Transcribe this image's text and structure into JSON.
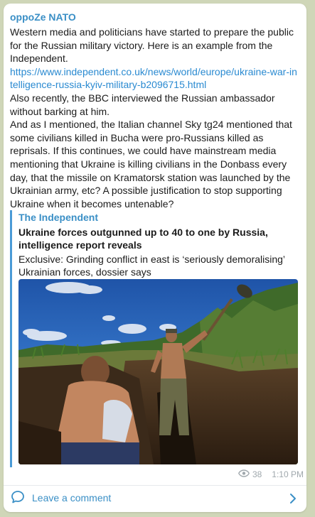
{
  "channel": {
    "name": "oppoZe NATO"
  },
  "message": {
    "p1": "Western media and politicians have started to prepare the public for the Russian military victory. Here is an example from the Independent.",
    "link": "https://www.independent.co.uk/news/world/europe/ukraine-war-intelligence-russia-kyiv-military-b2096715.html",
    "p2": "Also recently, the BBC interviewed the Russian ambassador without barking at him.",
    "p3": "And as I mentioned, the Italian channel Sky tg24 mentioned that some civilians killed in Bucha were pro-Russians killed as reprisals. If this continues, we could have mainstream media mentioning that Ukraine is killing civilians in the Donbass every day, that the missile on Kramatorsk station was launched by the Ukrainian army, etc? A possible justification to stop supporting Ukraine when it becomes untenable?"
  },
  "preview": {
    "site": "The Independent",
    "title": "Ukraine forces outgunned up to 40 to one by Russia, intelligence report reveals",
    "description": "Exclusive: Grinding conflict in east is ‘seriously demoralising’ Ukrainian forces, dossier says"
  },
  "meta": {
    "views": "38",
    "time": "1:10 PM",
    "view_icon": "eye-icon"
  },
  "footer": {
    "comment_label": "Leave a comment",
    "comment_icon": "comment-icon",
    "chevron_icon": "chevron-right-icon"
  },
  "colors": {
    "accent": "#3a8fc6",
    "link": "#2a8ad1",
    "background": "#cfd6b8"
  }
}
